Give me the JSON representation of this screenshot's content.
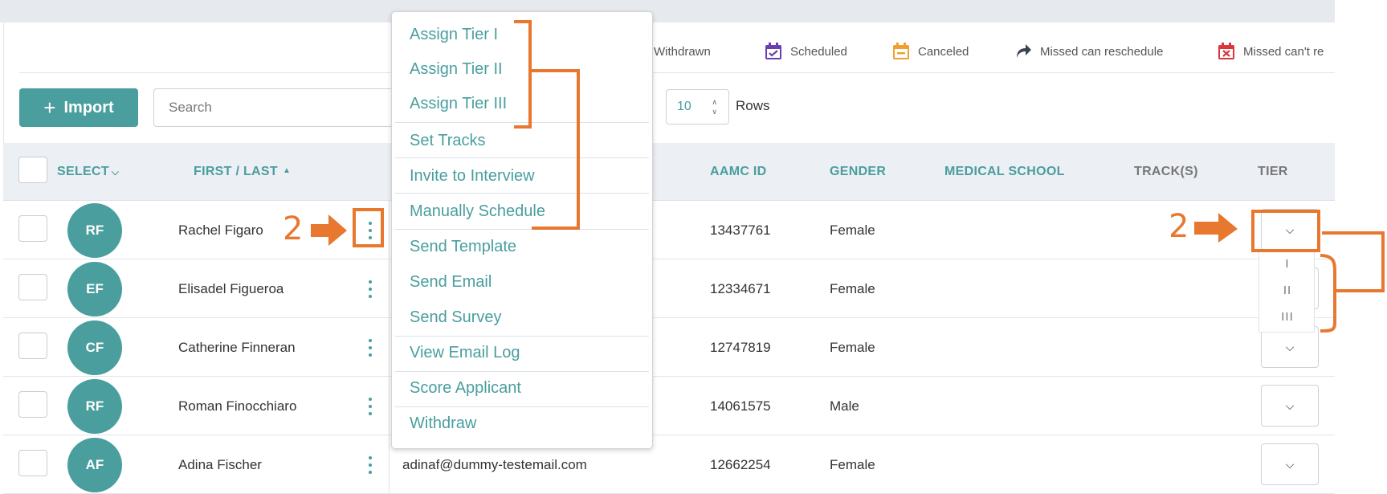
{
  "legend": [
    {
      "label": "Withdrawn",
      "icon": "withdrawn-icon",
      "color": "#b04aa0"
    },
    {
      "label": "Scheduled",
      "icon": "calendar-check-icon",
      "color": "#6a3fb3"
    },
    {
      "label": "Canceled",
      "icon": "calendar-canceled-icon",
      "color": "#f0a030"
    },
    {
      "label": "Missed can reschedule",
      "icon": "reschedule-arrow-icon",
      "color": "#3a4350"
    },
    {
      "label": "Missed can't re",
      "icon": "calendar-missed-icon",
      "color": "#d9363e"
    }
  ],
  "toolbar": {
    "import_label": "Import",
    "search_placeholder": "Search",
    "rows_value": "10",
    "rows_label": "Rows"
  },
  "table": {
    "columns": {
      "select": "SELECT",
      "name": "FIRST / LAST",
      "aamc": "AAMC ID",
      "gender": "GENDER",
      "school": "MEDICAL SCHOOL",
      "tracks": "TRACK(S)",
      "tier": "TIER"
    },
    "rows": [
      {
        "initials": "RF",
        "name": "Rachel Figaro",
        "email": "",
        "aamc": "13437761",
        "gender": "Female"
      },
      {
        "initials": "EF",
        "name": "Elisadel Figueroa",
        "email": "",
        "aamc": "12334671",
        "gender": "Female"
      },
      {
        "initials": "CF",
        "name": "Catherine Finneran",
        "email": "",
        "aamc": "12747819",
        "gender": "Female"
      },
      {
        "initials": "RF",
        "name": "Roman Finocchiaro",
        "email": "",
        "aamc": "14061575",
        "gender": "Male"
      },
      {
        "initials": "AF",
        "name": "Adina Fischer",
        "email": "adinaf@dummy-testemail.com",
        "aamc": "12662254",
        "gender": "Female"
      }
    ]
  },
  "action_menu": {
    "items": [
      "Assign Tier I",
      "Assign Tier II",
      "Assign Tier III",
      "Set Tracks",
      "Invite to Interview",
      "Manually Schedule",
      "Send Template",
      "Send Email",
      "Send Survey",
      "View Email Log",
      "Score Applicant",
      "Withdraw"
    ]
  },
  "tier_dropdown": {
    "options": [
      "I",
      "II",
      "III"
    ]
  },
  "annotations": {
    "left_number": "2",
    "right_number": "2",
    "color": "#e87830"
  },
  "colors": {
    "accent": "#4a9e9e",
    "annotation": "#e87830"
  }
}
